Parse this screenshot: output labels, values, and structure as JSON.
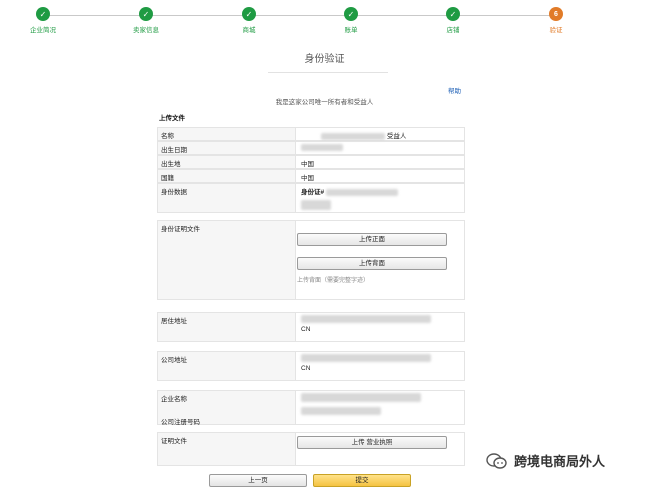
{
  "stepper": {
    "steps": [
      {
        "label": "企业简况",
        "status": "done"
      },
      {
        "label": "卖家信息",
        "status": "done"
      },
      {
        "label": "商城",
        "status": "done"
      },
      {
        "label": "账单",
        "status": "done"
      },
      {
        "label": "店铺",
        "status": "done"
      },
      {
        "label": "验证",
        "status": "current",
        "number": "6"
      }
    ]
  },
  "page": {
    "title": "身份验证",
    "help": "帮助",
    "intro": "我是这家公司唯一所有者和受益人"
  },
  "upload_section": {
    "title": "上传文件",
    "name_label": "名称",
    "name_suffix": "受益人",
    "dob_label": "出生日期",
    "birthplace_label": "出生地",
    "birthplace_value": "中国",
    "nationality_label": "国籍",
    "nationality_value": "中国",
    "id_label": "身份数据",
    "id_prefix": "身份证#",
    "id_docs_label": "身份证明文件",
    "upload_front": "上传正面",
    "upload_back": "上传背面",
    "upload_hint": "上传背面（需要完整字迹）",
    "residence_label": "居住地址",
    "residence_country": "CN",
    "company_address_label": "公司地址",
    "company_country": "CN",
    "company_name_label": "企业名称",
    "reg_number_label": "公司注册号码",
    "other_docs_label": "证明文件",
    "upload_license": "上传 营业执照"
  },
  "footer": {
    "prev": "上一页",
    "submit": "提交"
  },
  "watermark": {
    "text": "跨境电商局外人"
  },
  "colors": {
    "done": "#1f9b43",
    "current": "#e17b28",
    "submit": "#f5c342",
    "link": "#1a5db5"
  }
}
